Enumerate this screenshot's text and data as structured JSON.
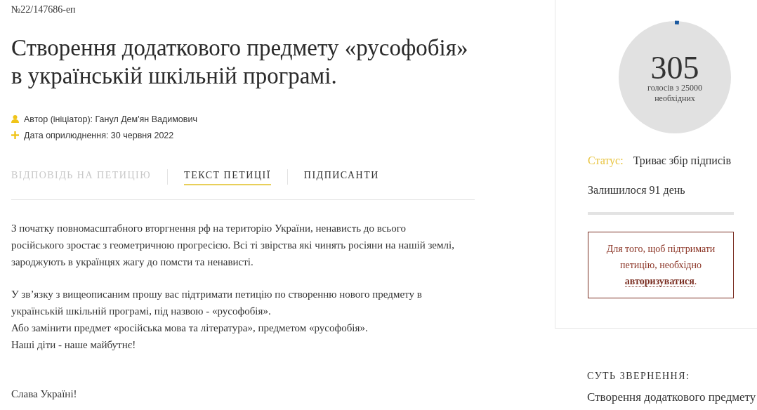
{
  "petition_number": "№22/147686-еп",
  "title": "Створення додаткового предмету «русофобія» в українській шкільній програмі.",
  "meta": [
    {
      "kind": "author",
      "text": "Автор (ініціатор): Ганул Дем'ян Вадимович"
    },
    {
      "kind": "date",
      "text": "Дата оприлюднення: 30 червня 2022"
    }
  ],
  "tabs": [
    {
      "label": "ВІДПОВІДЬ НА ПЕТИЦІЮ",
      "selected": false,
      "disabled": true
    },
    {
      "label": "ТЕКСТ ПЕТИЦІЇ",
      "selected": true,
      "disabled": false
    },
    {
      "label": "ПІДПИСАНТИ",
      "selected": false,
      "disabled": false
    }
  ],
  "body": [
    {
      "lines": [
        "З початку повномасштабного вторгнення рф на територію України, ненависть до всього російського зростає з геометричною прогресією. Всі ті звірства які чинять росіяни на нашій землі, зароджують в українцях жагу до помсти та ненависті."
      ]
    },
    {
      "lines": [
        "У зв’язку з вищеописаним прошу вас підтримати петицію по створенню нового предмету в українській шкільній програмі, під назвою - «русофобія».",
        "Або замінити предмет «російська мова та література», предметом «русофобія».",
        "Наші діти - наше майбутнє!"
      ]
    },
    {
      "lines": [
        "Слава Україні!"
      ]
    }
  ],
  "votes": {
    "count": "305",
    "caption": "голосів з 25000 необхідних"
  },
  "status": {
    "label": "Статус:",
    "value": "Триває збір підписів"
  },
  "remaining": "Залишилося 91 день",
  "notice": {
    "text": "Для того, щоб підтримати петицію, необхідно",
    "link": "авторизуватися",
    "after": "."
  },
  "summary": {
    "heading": "СУТЬ ЗВЕРНЕННЯ:",
    "text": "Створення додаткового предмету"
  }
}
